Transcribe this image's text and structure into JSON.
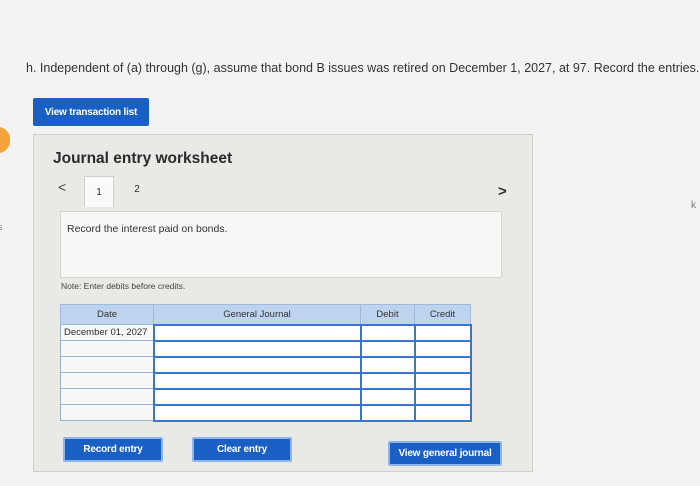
{
  "question": "h. Independent of (a) through (g), assume that bond B issues was retired on December 1, 2027, at 97. Record the entries.",
  "view_transaction_list": "View transaction list",
  "worksheet": {
    "title": "Journal entry worksheet",
    "nav_prev": "<",
    "nav_next": ">",
    "tabs": [
      "1",
      "2"
    ],
    "instruction": "Record the interest paid on bonds.",
    "note": "Note: Enter debits before credits.",
    "columns": {
      "date": "Date",
      "account": "General Journal",
      "debit": "Debit",
      "credit": "Credit"
    },
    "rows": [
      {
        "date": "December 01, 2027"
      },
      {
        "date": ""
      },
      {
        "date": ""
      },
      {
        "date": ""
      },
      {
        "date": ""
      },
      {
        "date": ""
      }
    ],
    "record_entry": "Record entry",
    "clear_entry": "Clear entry",
    "view_general_journal": "View general journal"
  },
  "colors": {
    "button_blue": "#1a5fc4",
    "header_blue": "#bed3ed",
    "accent_orange": "#f2a33a"
  },
  "margin_marks": {
    "left": "s",
    "right": "k"
  }
}
